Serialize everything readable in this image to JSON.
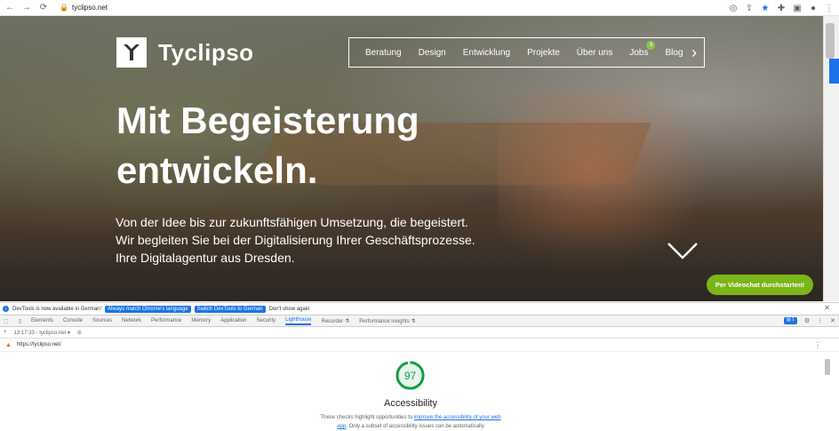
{
  "browser": {
    "url": "tyclipso.net"
  },
  "hero": {
    "logo_text": "Tyclipso",
    "nav": [
      "Beratung",
      "Design",
      "Entwicklung",
      "Projekte",
      "Über uns",
      "Jobs",
      "Blog"
    ],
    "jobs_badge": "3",
    "headline_line1": "Mit Begeisterung",
    "headline_line2": "entwickeln.",
    "sub_line1": "Von der Idee bis zur zukunftsfähigen Umsetzung, die begeistert.",
    "sub_line2": "Wir begleiten Sie bei der Digitalisierung Ihrer Geschäftsprozesse.",
    "sub_line3": "Ihre Digitalagentur aus Dresden.",
    "cta": "Per Videochat durchstarten!"
  },
  "devtools": {
    "info_text": "DevTools is now available in German!",
    "btn_match": "Always match Chrome's language",
    "btn_switch": "Switch DevTools to German",
    "btn_dismiss": "Don't show again",
    "tabs": [
      "Elements",
      "Console",
      "Sources",
      "Network",
      "Performance",
      "Memory",
      "Application",
      "Security",
      "Lighthouse",
      "Recorder",
      "Performance insights"
    ],
    "issues_count": "1",
    "report_label": "13:17:33 - tyclipso.net",
    "page_url": "https://tyclipso.net/"
  },
  "lighthouse": {
    "score": "97",
    "category": "Accessibility",
    "desc_before": "These checks highlight opportunities to",
    "desc_link": "improve the accessibility of your web app",
    "desc_after": ". Only a subset of accessibility issues can be automatically"
  }
}
